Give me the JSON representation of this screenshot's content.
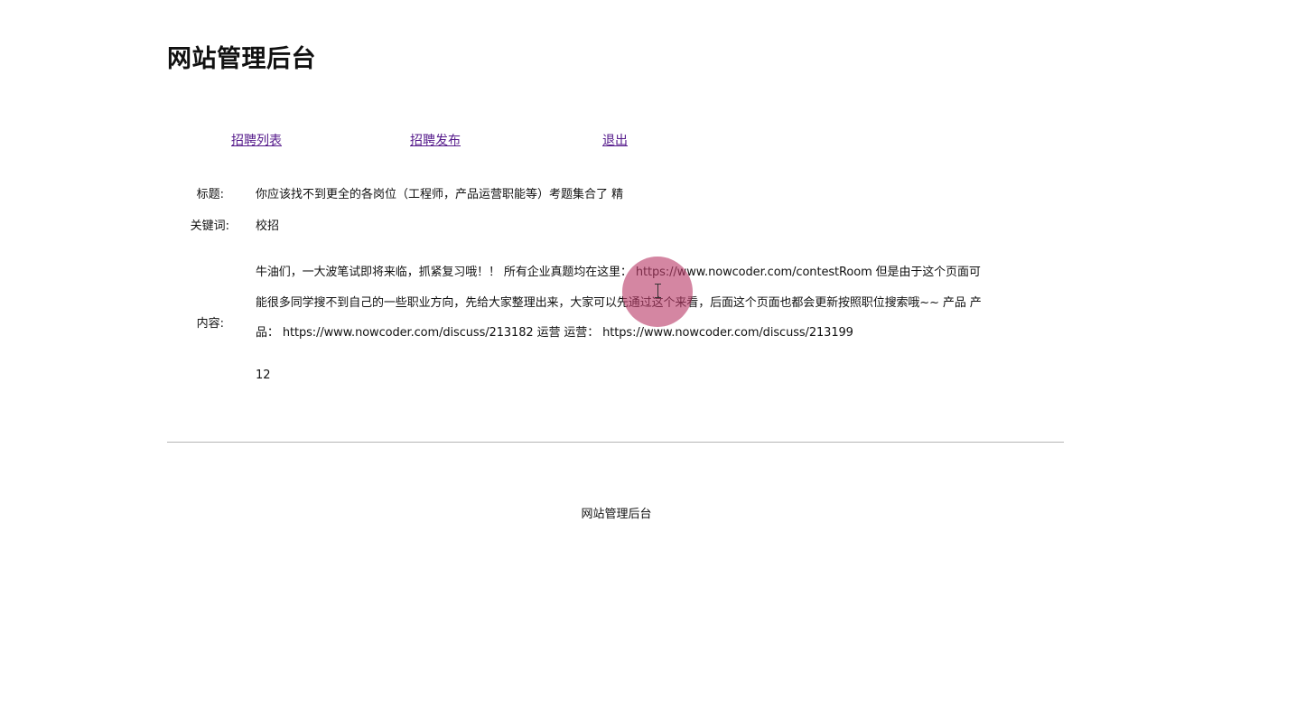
{
  "header": {
    "title": "网站管理后台"
  },
  "nav": {
    "items": [
      {
        "label": "招聘列表"
      },
      {
        "label": "招聘发布"
      },
      {
        "label": "退出"
      }
    ]
  },
  "detail": {
    "title_label": "标题:",
    "title_value": "你应该找不到更全的各岗位（工程师，产品运营职能等）考题集合了 精",
    "keyword_label": "关键词:",
    "keyword_value": "校招",
    "content_label": "内容:",
    "content_lines": [
      "牛油们，一大波笔试即将来临，抓紧复习哦！！ 所有企业真题均在这里： https://www.nowcoder.com/contestRoom 但是由于这个页面可",
      "能很多同学搜不到自己的一些职业方向，先给大家整理出来，大家可以先通过这个来看，后面这个页面也都会更新按照职位搜索哦~~ 产品 产",
      "品： https://www.nowcoder.com/discuss/213182 运营 运营： https://www.nowcoder.com/discuss/213199"
    ],
    "number_value": "12"
  },
  "footer": {
    "text": "网站管理后台"
  },
  "overlay": {
    "cursor_highlight_color": "#b93c69",
    "cursor_icon": "text-cursor-icon"
  }
}
